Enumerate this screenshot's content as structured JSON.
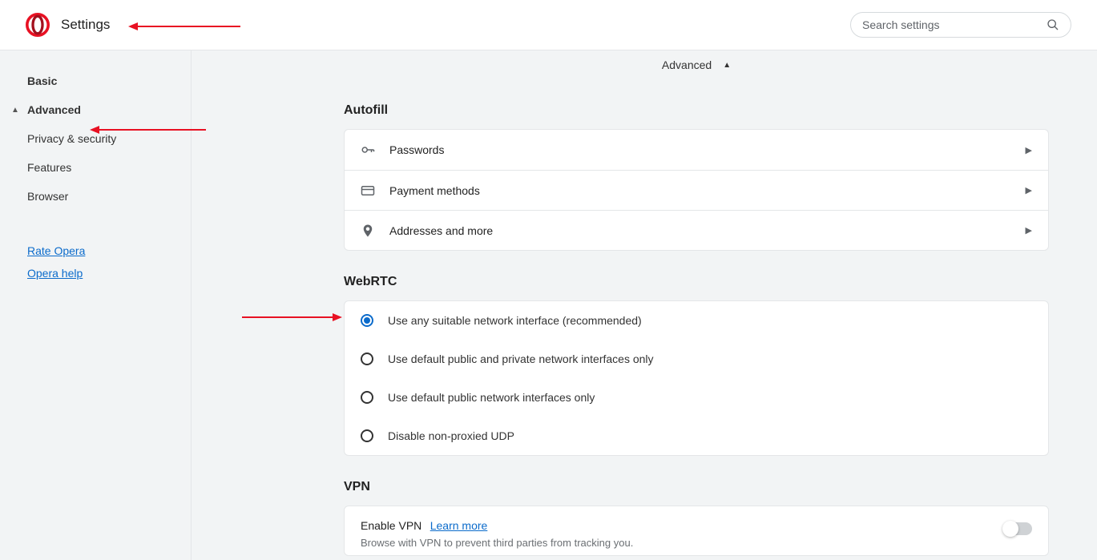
{
  "header": {
    "title": "Settings",
    "search_placeholder": "Search settings"
  },
  "sidebar": {
    "basic": "Basic",
    "advanced": "Advanced",
    "items": [
      "Privacy & security",
      "Features",
      "Browser"
    ],
    "links": [
      "Rate Opera",
      "Opera help"
    ]
  },
  "advanced_tab": "Advanced",
  "sections": {
    "autofill": {
      "title": "Autofill",
      "rows": [
        "Passwords",
        "Payment methods",
        "Addresses and more"
      ]
    },
    "webrtc": {
      "title": "WebRTC",
      "options": [
        "Use any suitable network interface (recommended)",
        "Use default public and private network interfaces only",
        "Use default public network interfaces only",
        "Disable non-proxied UDP"
      ],
      "selected": 0
    },
    "vpn": {
      "title": "VPN",
      "enable_label": "Enable VPN",
      "learn_more": "Learn more",
      "desc": "Browse with VPN to prevent third parties from tracking you."
    }
  }
}
